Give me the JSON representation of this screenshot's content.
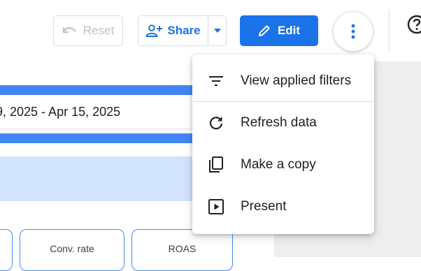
{
  "toolbar": {
    "reset_label": "Reset",
    "share_label": "Share",
    "edit_label": "Edit",
    "icons": {
      "reset": "undo-icon",
      "share": "person-add-icon",
      "share_menu": "caret-down-icon",
      "edit": "pencil-icon",
      "more": "more-vertical-icon",
      "help": "help-icon"
    }
  },
  "report": {
    "date_range": "9, 2025 - Apr 15, 2025",
    "scorecards": [
      "",
      "Conv. rate",
      "ROAS"
    ]
  },
  "menu": {
    "items": [
      {
        "label": "View applied filters",
        "icon": "filter-list-icon"
      },
      {
        "label": "Refresh data",
        "icon": "refresh-icon"
      },
      {
        "label": "Make a copy",
        "icon": "copy-icon"
      },
      {
        "label": "Present",
        "icon": "present-icon"
      }
    ]
  },
  "colors": {
    "primary": "#1a73e8",
    "accent_bar": "#4285f4",
    "light_band": "#d2e3fc",
    "disabled_text": "#bdc1c6",
    "canvas_bg": "#eeeeee"
  }
}
